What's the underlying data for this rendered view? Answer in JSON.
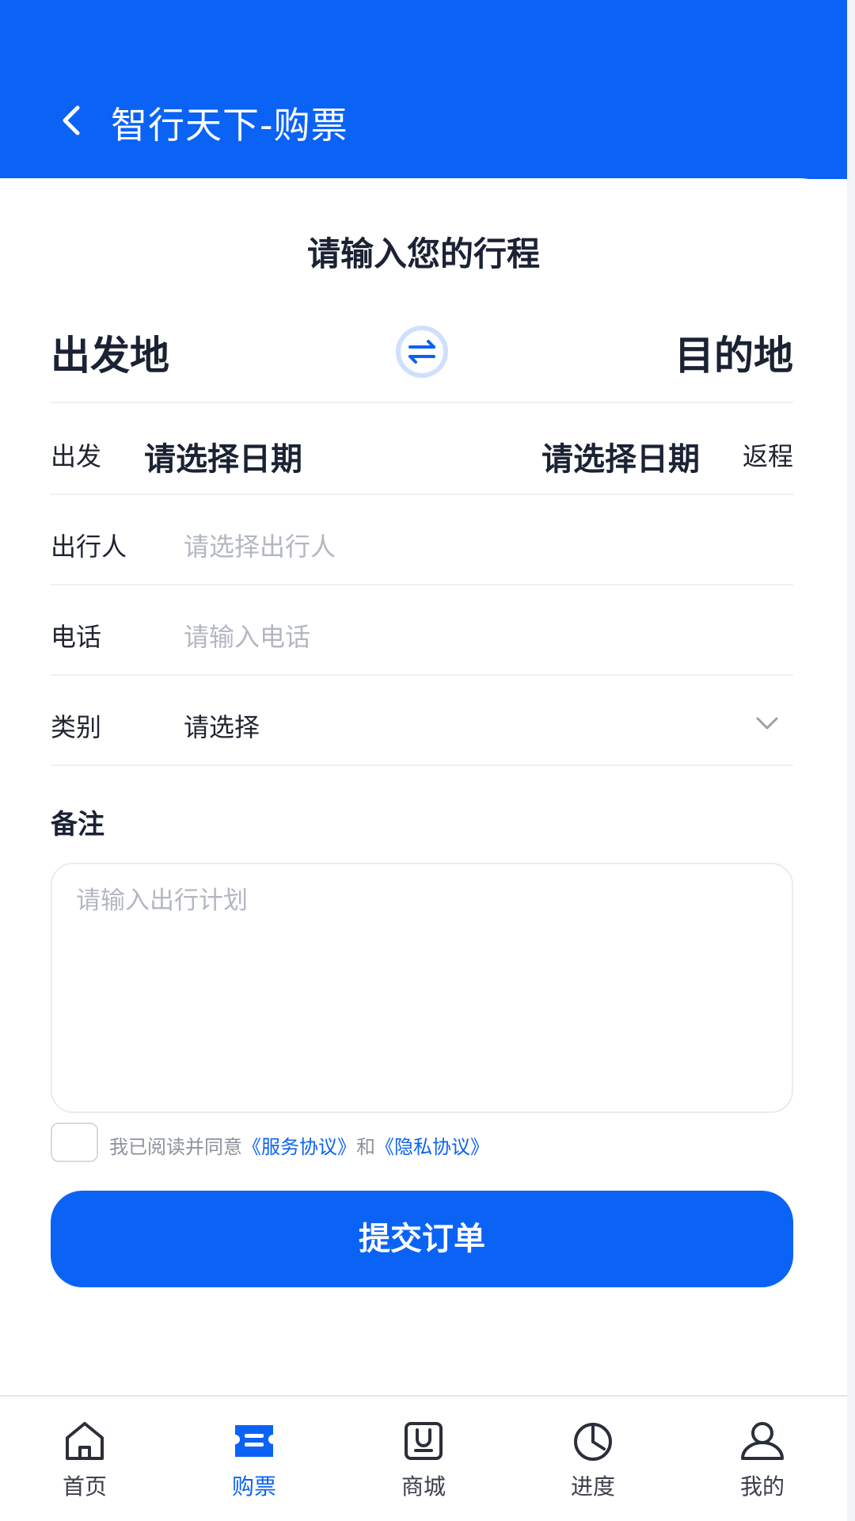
{
  "header": {
    "title": "智行天下-购票"
  },
  "form": {
    "section_title": "请输入您的行程",
    "from_city": "出发地",
    "to_city": "目的地",
    "depart_label": "出发",
    "depart_date": "请选择日期",
    "return_date": "请选择日期",
    "return_label": "返程",
    "traveler_label": "出行人",
    "traveler_placeholder": "请选择出行人",
    "phone_label": "电话",
    "phone_placeholder": "请输入电话",
    "type_label": "类别",
    "type_value": "请选择",
    "notes_label": "备注",
    "notes_placeholder": "请输入出行计划"
  },
  "agreement": {
    "prefix": "我已阅读并同意",
    "service_link": "《服务协议》",
    "and": "和",
    "privacy_link": "《隐私协议》",
    "checked": false
  },
  "submit": {
    "label": "提交订单"
  },
  "tabbar": {
    "items": [
      {
        "label": "首页",
        "icon": "home-icon",
        "active": false
      },
      {
        "label": "购票",
        "icon": "ticket-icon",
        "active": true
      },
      {
        "label": "商城",
        "icon": "shop-icon",
        "active": false
      },
      {
        "label": "进度",
        "icon": "progress-icon",
        "active": false
      },
      {
        "label": "我的",
        "icon": "user-icon",
        "active": false
      }
    ]
  },
  "colors": {
    "brand": "#0a63f5",
    "text_dark": "#1b2233",
    "placeholder": "#b3b7c0"
  }
}
